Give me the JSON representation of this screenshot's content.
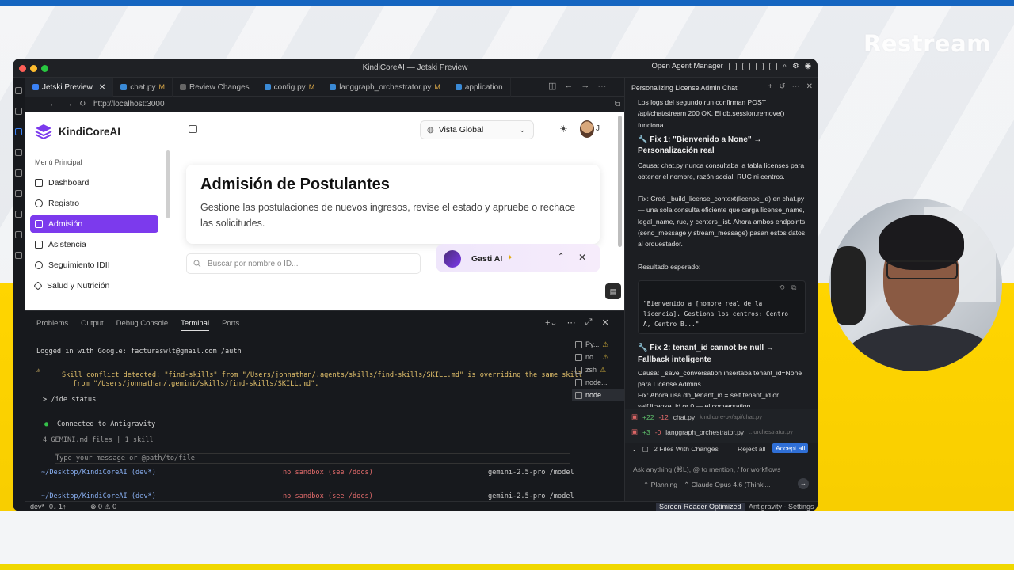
{
  "overlay": {
    "brand": "Restream"
  },
  "window": {
    "title": "KindiCoreAI — Jetski Preview",
    "right_label": "Open Agent Manager"
  },
  "tabs": [
    {
      "label": "Jetski Preview",
      "modified": "",
      "active": true
    },
    {
      "label": "chat.py",
      "modified": "M",
      "active": false
    },
    {
      "label": "Review Changes",
      "modified": "",
      "active": false
    },
    {
      "label": "config.py",
      "modified": "M",
      "active": false
    },
    {
      "label": "langgraph_orchestrator.py",
      "modified": "M",
      "active": false
    },
    {
      "label": "application",
      "modified": "",
      "active": false
    }
  ],
  "url": "http://localhost:3000",
  "app": {
    "brand": "KindiCoreAI",
    "menu_header": "Menú Principal",
    "menu": [
      "Dashboard",
      "Registro",
      "Admisión",
      "Asistencia",
      "Seguimiento IDII",
      "Salud y Nutrición"
    ],
    "selected_menu": "Admisión",
    "scope": "Vista Global",
    "avatar_initial": "J",
    "page_title": "Admisión de Postulantes",
    "page_desc": "Gestione las postulaciones de nuevos ingresos, revise el estado y apruebe o rechace las solicitudes.",
    "search_placeholder": "Buscar por nombre o ID...",
    "assistant_name": "Gasti AI"
  },
  "panel": {
    "tabs": [
      "Problems",
      "Output",
      "Debug Console",
      "Terminal",
      "Ports"
    ],
    "active_tab": "Terminal",
    "lines": {
      "login": "Logged in with Google: facturaswlt@gmail.com /auth",
      "warn1": "Skill conflict detected: \"find-skills\" from \"/Users/jonnathan/.agents/skills/find-skills/SKILL.md\" is overriding the same skill",
      "warn2": "from \"/Users/jonnathan/.gemini/skills/find-skills/SKILL.md\".",
      "cmd": "> /ide status",
      "connected": "Connected to Antigravity",
      "files": "4 GEMINI.md files | 1 skill",
      "prompt": "Type your message or @path/to/file",
      "cwd1": "~/Desktop/KindiCoreAI (dev*)",
      "sandbox1": "no sandbox (see /docs)",
      "model1": "gemini-2.5-pro /model",
      "cwd2": "~/Desktop/KindiCoreAI (dev*)",
      "sandbox2": "no sandbox (see /docs)",
      "model2": "gemini-2.5-pro /model"
    },
    "terminals": [
      "Py...",
      "no...",
      "zsh",
      "node...",
      "node"
    ],
    "active_terminal": "node"
  },
  "status": {
    "branch": "dev*",
    "sync": "0↓ 1↑",
    "problems": "⊗ 0 ⚠ 0",
    "screen_reader": "Screen Reader Optimized",
    "settings": "Antigravity - Settings"
  },
  "agent": {
    "title": "Personalizing License Admin Chat",
    "intro": "Los logs del segundo run confirman POST /api/chat/stream 200 OK. El db.session.remove() funciona.",
    "fix1_title": "🔧 Fix 1: \"Bienvenido a None\" → Personalización real",
    "fix1_cause": "Causa: chat.py nunca consultaba la tabla licenses para obtener el nombre, razón social, RUC ni centros.",
    "fix1_fix": "Fix: Creé _build_license_context(license_id) en chat.py — una sola consulta eficiente que carga license_name, legal_name, ruc, y centers_list. Ahora ambos endpoints (send_message y stream_message) pasan estos datos al orquestador.",
    "expected_label": "Resultado esperado:",
    "expected_code": "\"Bienvenido a [nombre real de la\nlicencia]. Gestiona los centros: Centro\nA, Centro B...\"",
    "fix2_title": "🔧 Fix 2: tenant_id cannot be null → Fallback inteligente",
    "fix2_cause": "Causa: _save_conversation insertaba tenant_id=None para License Admins.",
    "fix2_fix": "Fix: Ahora usa db_tenant_id = self.tenant_id or self.license_id or 0 — el conversation",
    "changes": [
      {
        "add": "+22",
        "del": "-12",
        "file": "chat.py",
        "path": "kindicore-py/api/chat.py"
      },
      {
        "add": "+3",
        "del": "-0",
        "file": "langgraph_orchestrator.py",
        "path": "...orchestrator.py"
      }
    ],
    "files_changed": "2 Files With Changes",
    "reject_all": "Reject all",
    "accept_all": "Accept all",
    "ask_placeholder": "Ask anything (⌘L), @ to mention, / for workflows",
    "mode": "Planning",
    "model": "Claude Opus 4.6 (Thinki..."
  }
}
